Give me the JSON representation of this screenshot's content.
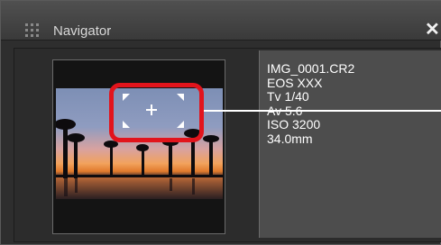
{
  "window": {
    "title": "Navigator",
    "close_glyph": "✕"
  },
  "info": {
    "lines": [
      "IMG_0001.CR2",
      "EOS XXX",
      "Tv 1/40",
      "Av 5.6",
      "ISO 3200",
      "34.0mm"
    ]
  },
  "colors": {
    "callout": "#e2141c",
    "panel_bg": "#2e2e2e",
    "info_bg": "#4d4d4d"
  },
  "icons": {
    "grip": "grip-icon",
    "close": "close-icon",
    "crosshair": "crosshair-icon"
  }
}
